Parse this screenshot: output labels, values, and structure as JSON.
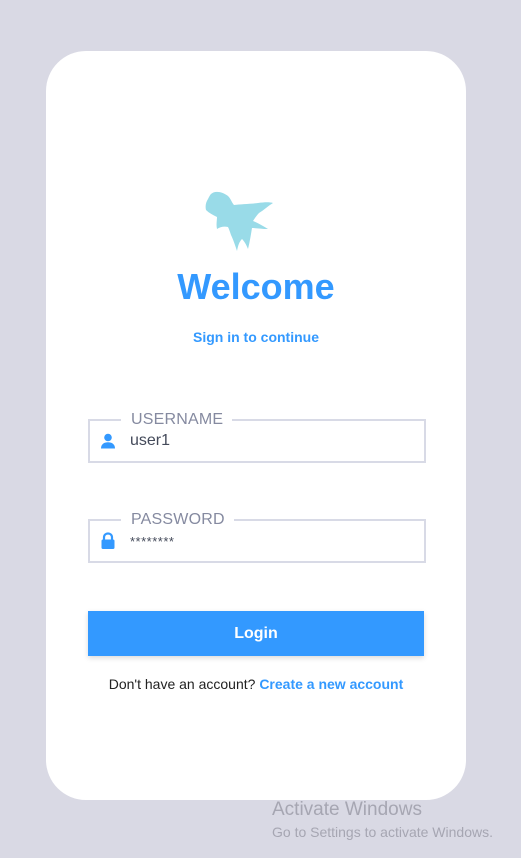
{
  "login": {
    "title": "Welcome",
    "subtitle": "Sign in to continue",
    "username": {
      "label": "USERNAME",
      "value": "user1",
      "icon": "user-icon"
    },
    "password": {
      "label": "PASSWORD",
      "value": "********",
      "icon": "lock-icon"
    },
    "login_button": "Login",
    "signup_prompt": "Don't have an account?",
    "signup_link": "Create a new account"
  },
  "watermark": {
    "title": "Activate Windows",
    "subtitle": "Go to Settings to activate Windows."
  },
  "colors": {
    "accent": "#3399ff",
    "background": "#d9d9e4",
    "card": "#ffffff",
    "logo": "#99dbe8",
    "border": "#d8dae6"
  }
}
